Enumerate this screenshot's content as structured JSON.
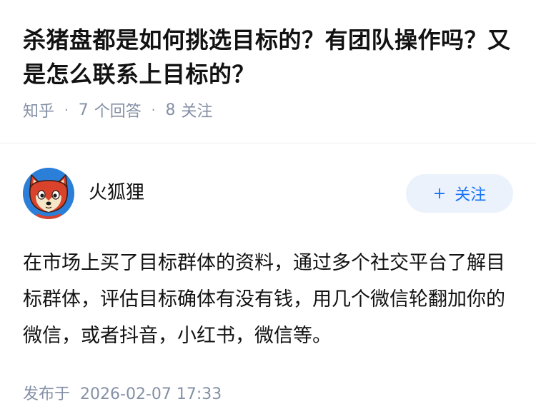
{
  "question": {
    "title": "杀猪盘都是如何挑选目标的？有团队操作吗？又是怎么联系上目标的？",
    "source": "知乎",
    "answer_count": "7",
    "answer_label": "个回答",
    "follower_count": "8",
    "follower_label": "关注"
  },
  "answer": {
    "author_name": "火狐狸",
    "follow_plus": "+",
    "follow_label": "关注",
    "content": "在市场上买了目标群体的资料，通过多个社交平台了解目标群体，评估目标确体有没有钱，用几个微信轮翻加你的微信，或者抖音，小红书，微信等。",
    "published_label": "发布于",
    "published_date": "2026-02-07 17:33"
  },
  "colors": {
    "meta_gray": "#8590a6",
    "follow_bg": "#ebf2fc",
    "follow_text": "#1772f6",
    "avatar_bg": "#2b7fd9"
  }
}
